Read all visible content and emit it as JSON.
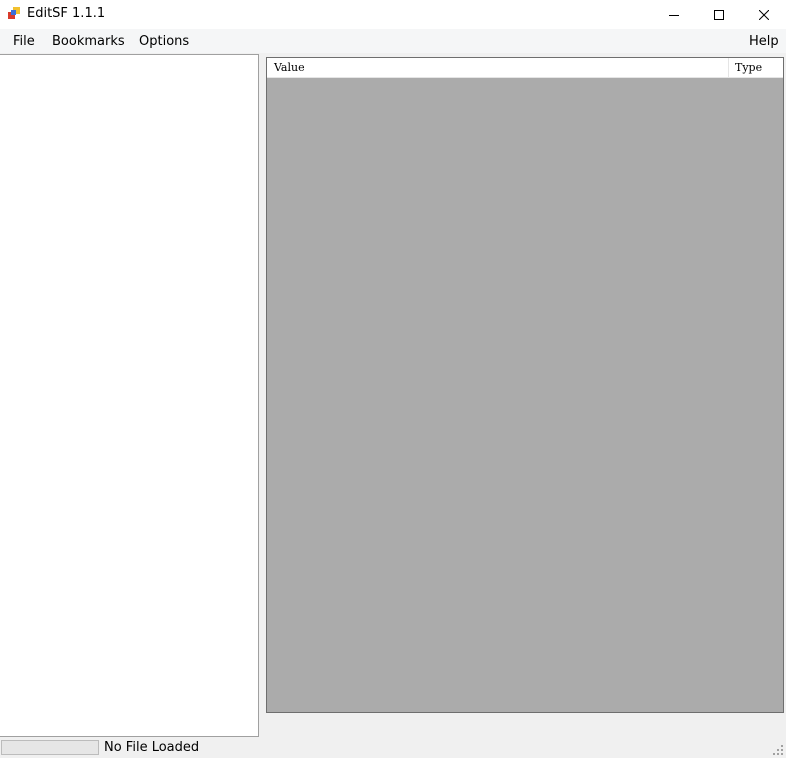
{
  "window": {
    "title": "EditSF 1.1.1",
    "icons": {
      "app": "editsf-app-icon",
      "minimize": "minimize-icon",
      "maximize": "maximize-icon",
      "close": "close-icon"
    }
  },
  "menu": {
    "file": "File",
    "bookmarks": "Bookmarks",
    "options": "Options",
    "help": "Help"
  },
  "list": {
    "columns": [
      "Value",
      "Type"
    ],
    "rows": []
  },
  "status": {
    "text": "No File Loaded",
    "progress": 0
  },
  "colors": {
    "list_background": "#ababab",
    "tree_background": "#ffffff",
    "chrome": "#f0f0f0"
  }
}
